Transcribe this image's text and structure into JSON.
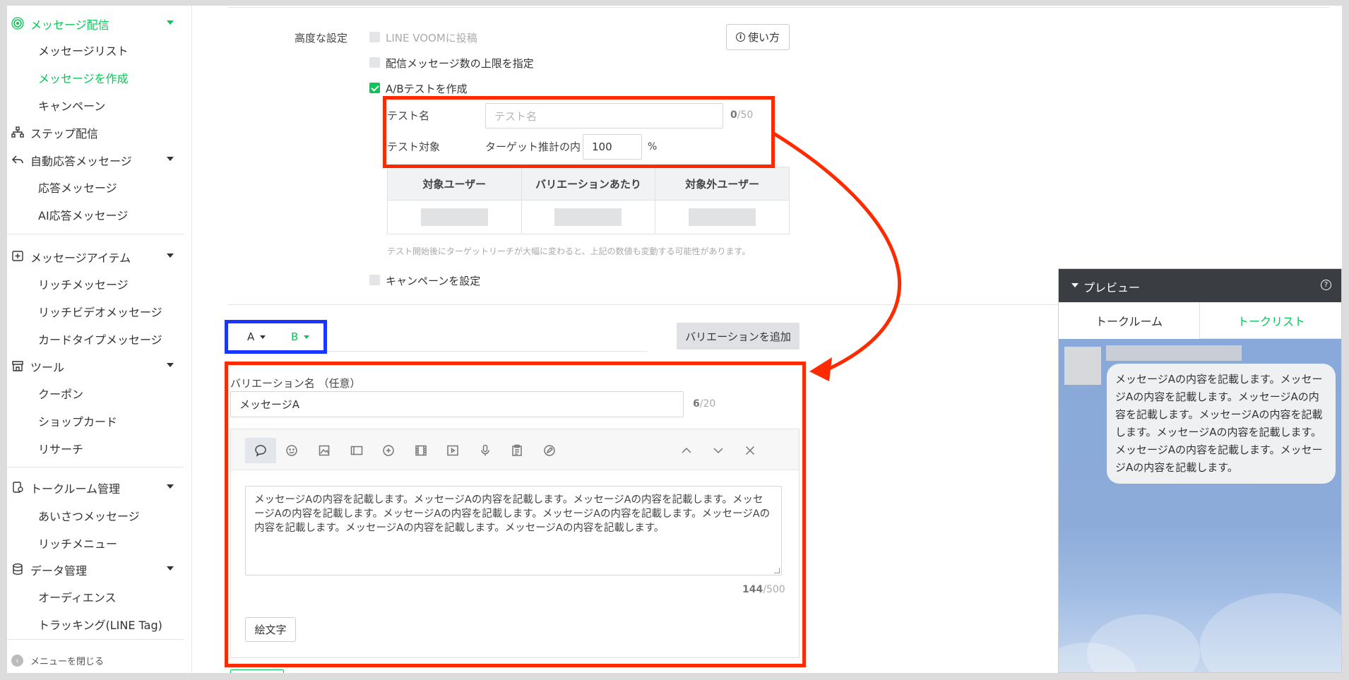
{
  "sidebar": {
    "groups": {
      "broadcast": {
        "label": "メッセージ配信",
        "items": [
          "メッセージリスト",
          "メッセージを作成",
          "キャンペーン"
        ]
      },
      "step": {
        "label": "ステップ配信"
      },
      "autoreply": {
        "label": "自動応答メッセージ",
        "items": [
          "応答メッセージ",
          "AI応答メッセージ"
        ]
      },
      "items": {
        "label": "メッセージアイテム",
        "items": [
          "リッチメッセージ",
          "リッチビデオメッセージ",
          "カードタイプメッセージ"
        ]
      },
      "tools": {
        "label": "ツール",
        "items": [
          "クーポン",
          "ショップカード",
          "リサーチ"
        ]
      },
      "talkroom": {
        "label": "トークルーム管理",
        "items": [
          "あいさつメッセージ",
          "リッチメニュー"
        ]
      },
      "data": {
        "label": "データ管理",
        "items": [
          "オーディエンス",
          "トラッキング(LINE Tag)"
        ]
      }
    },
    "close_menu": "メニューを閉じる"
  },
  "advanced": {
    "label": "高度な設定",
    "voom": "LINE VOOMに投稿",
    "limit": "配信メッセージ数の上限を指定",
    "ab": "A/Bテストを作成",
    "help": "使い方",
    "test_name_label": "テスト名",
    "test_name_placeholder": "テスト名",
    "test_name_count": "0",
    "test_name_max": "/50",
    "test_target_label": "テスト対象",
    "target_prefix": "ターゲット推計の内",
    "target_value": "100",
    "target_unit": "%",
    "table_headers": [
      "対象ユーザー",
      "バリエーションあたり",
      "対象外ユーザー"
    ],
    "note": "テスト開始後にターゲットリーチが大幅に変わると、上記の数値も変動する可能性があります。",
    "campaign": "キャンペーンを設定"
  },
  "variations": {
    "tabs": [
      "A",
      "B"
    ],
    "add_button": "バリエーションを追加",
    "name_label": "バリエーション名 （任意）",
    "name_value": "メッセージA",
    "name_count": "6",
    "name_max": "/20",
    "message_text": "メッセージAの内容を記載します。メッセージAの内容を記載します。メッセージAの内容を記載します。メッセージAの内容を記載します。メッセージAの内容を記載します。メッセージAの内容を記載します。メッセージAの内容を記載します。メッセージAの内容を記載します。メッセージAの内容を記載します。",
    "message_count": "144",
    "message_max": "/500",
    "emoji_button": "絵文字"
  },
  "preview": {
    "title": "プレビュー",
    "tab_talkroom": "トークルーム",
    "tab_talklist": "トークリスト",
    "bubble_text": "メッセージAの内容を記載します。メッセージAの内容を記載します。メッセージAの内容を記載します。メッセージAの内容を記載します。メッセージAの内容を記載します。メッセージAの内容を記載します。メッセージAの内容を記載します。"
  },
  "colors": {
    "accent": "#06c755",
    "annotation_red": "#ff2a00",
    "annotation_blue": "#1a35ff"
  }
}
